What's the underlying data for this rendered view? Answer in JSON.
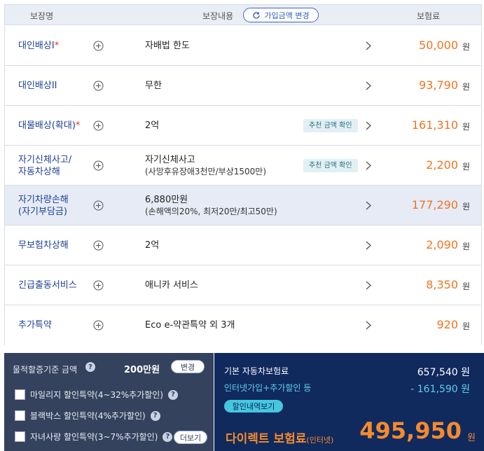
{
  "header": {
    "col_name": "보장명",
    "col_content": "보장내용",
    "change_amount_button": "가입금액 변경",
    "col_premium": "보험료"
  },
  "rows": [
    {
      "name": "대인배상I",
      "required_mark": "*",
      "desc": "자배법 한도",
      "desc_sub": "",
      "tag": "",
      "amount": "50,000",
      "unit": "원"
    },
    {
      "name": "대인배상II",
      "required_mark": "",
      "desc": "무한",
      "desc_sub": "",
      "tag": "",
      "amount": "93,790",
      "unit": "원"
    },
    {
      "name": "대물배상(확대)",
      "required_mark": "*",
      "desc": "2억",
      "desc_sub": "",
      "tag": "추천 금액 확인",
      "amount": "161,310",
      "unit": "원"
    },
    {
      "name": "자기신체사고/\n자동차상해",
      "required_mark": "",
      "desc": "자기신체사고",
      "desc_sub": "(사망후유장애3천만/부상1500만)",
      "tag": "추천 금액 확인",
      "amount": "2,200",
      "unit": "원"
    },
    {
      "name": "자기차량손해\n(자기부담금)",
      "required_mark": "",
      "desc": "6,880만원",
      "desc_sub": "(손해액의20%, 최저20만/최고50만)",
      "tag": "",
      "amount": "177,290",
      "unit": "원",
      "selected": true
    },
    {
      "name": "무보험차상해",
      "required_mark": "",
      "desc": "2억",
      "desc_sub": "",
      "tag": "",
      "amount": "2,090",
      "unit": "원"
    },
    {
      "name": "긴급출동서비스",
      "required_mark": "",
      "desc": "애니카 서비스",
      "desc_sub": "",
      "tag": "",
      "amount": "8,350",
      "unit": "원"
    },
    {
      "name": "추가특약",
      "required_mark": "",
      "desc": "Eco e-약관특약 외 3개",
      "desc_sub": "",
      "tag": "",
      "amount": "920",
      "unit": "원"
    }
  ],
  "options": {
    "property_label": "물적할증기준 금액",
    "property_value": "200만원",
    "change_button": "변경",
    "help_icon": "?",
    "mileage": "마일리지 할인특약(4~32%추가할인)",
    "blackbox": "블랙박스 할인특약(4%추가할인)",
    "child": "자녀사랑 할인특약(3~7%추가할인)",
    "more_button": "더보기"
  },
  "summary": {
    "base_label": "기본 자동차보험료",
    "base_value": "657,540 원",
    "discount_label": "인터넷가입+추가할인 등",
    "discount_value": "- 161,590 원",
    "discount_detail_button": "할인내역보기",
    "total_label": "다이렉트 보험료",
    "total_label_suffix": "(인터넷)",
    "total_value": "495,950",
    "total_unit": "원"
  },
  "colors": {
    "accent_orange": "#f07422",
    "name_blue": "#1c3f94",
    "summary_bg": "#102a5e",
    "options_bg": "#34425d",
    "discount_cyan": "#5fd0e8"
  }
}
